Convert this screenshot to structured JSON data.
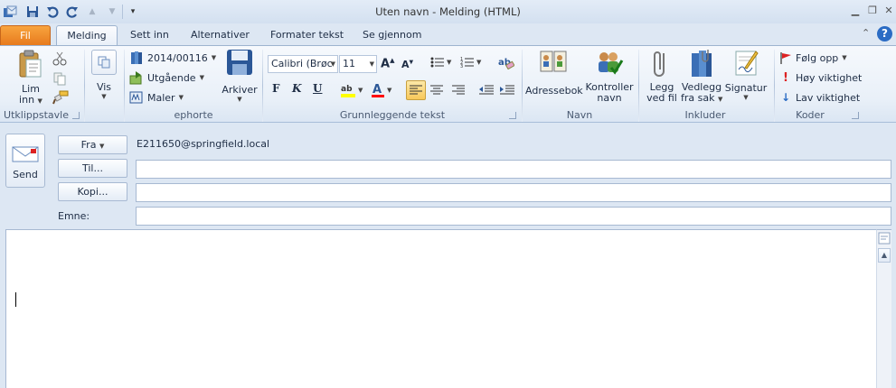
{
  "window": {
    "title": "Uten navn  -  Melding (HTML)"
  },
  "tabs": [
    {
      "label": "Fil"
    },
    {
      "label": "Melding"
    },
    {
      "label": "Sett inn"
    },
    {
      "label": "Alternativer"
    },
    {
      "label": "Formater tekst"
    },
    {
      "label": "Se gjennom"
    }
  ],
  "ribbon": {
    "clipboard": {
      "paste_label_line1": "Lim",
      "paste_label_line2": "inn",
      "group_label": "Utklippstavle"
    },
    "view": {
      "label": "Vis"
    },
    "ephorte": {
      "case_number": "2014/00116",
      "outgoing": "Utgående",
      "templates": "Maler",
      "group_label": "ephorte"
    },
    "archive": {
      "label": "Arkiver"
    },
    "basic_text": {
      "font": "Calibri (Brøc",
      "size": "11",
      "bold": "F",
      "italic": "K",
      "underline": "U",
      "group_label": "Grunnleggende tekst"
    },
    "names": {
      "address_book": "Adressebok",
      "check_names_line1": "Kontroller",
      "check_names_line2": "navn",
      "group_label": "Navn"
    },
    "include": {
      "attach_file_line1": "Legg",
      "attach_file_line2": "ved fil",
      "attach_case_line1": "Vedlegg",
      "attach_case_line2": "fra sak",
      "signature": "Signatur",
      "group_label": "Inkluder"
    },
    "tags": {
      "follow_up": "Følg opp",
      "high_importance": "Høy viktighet",
      "low_importance": "Lav viktighet",
      "group_label": "Koder"
    }
  },
  "compose": {
    "send_label": "Send",
    "from_label": "Fra",
    "from_value": "E211650@springfield.local",
    "to_label": "Til...",
    "cc_label": "Kopi...",
    "subject_label": "Emne:"
  },
  "colors": {
    "file_tab": "#e6781c",
    "highlight": "#ffff00",
    "font_color": "#ff0000",
    "accent": "#2b5797"
  }
}
